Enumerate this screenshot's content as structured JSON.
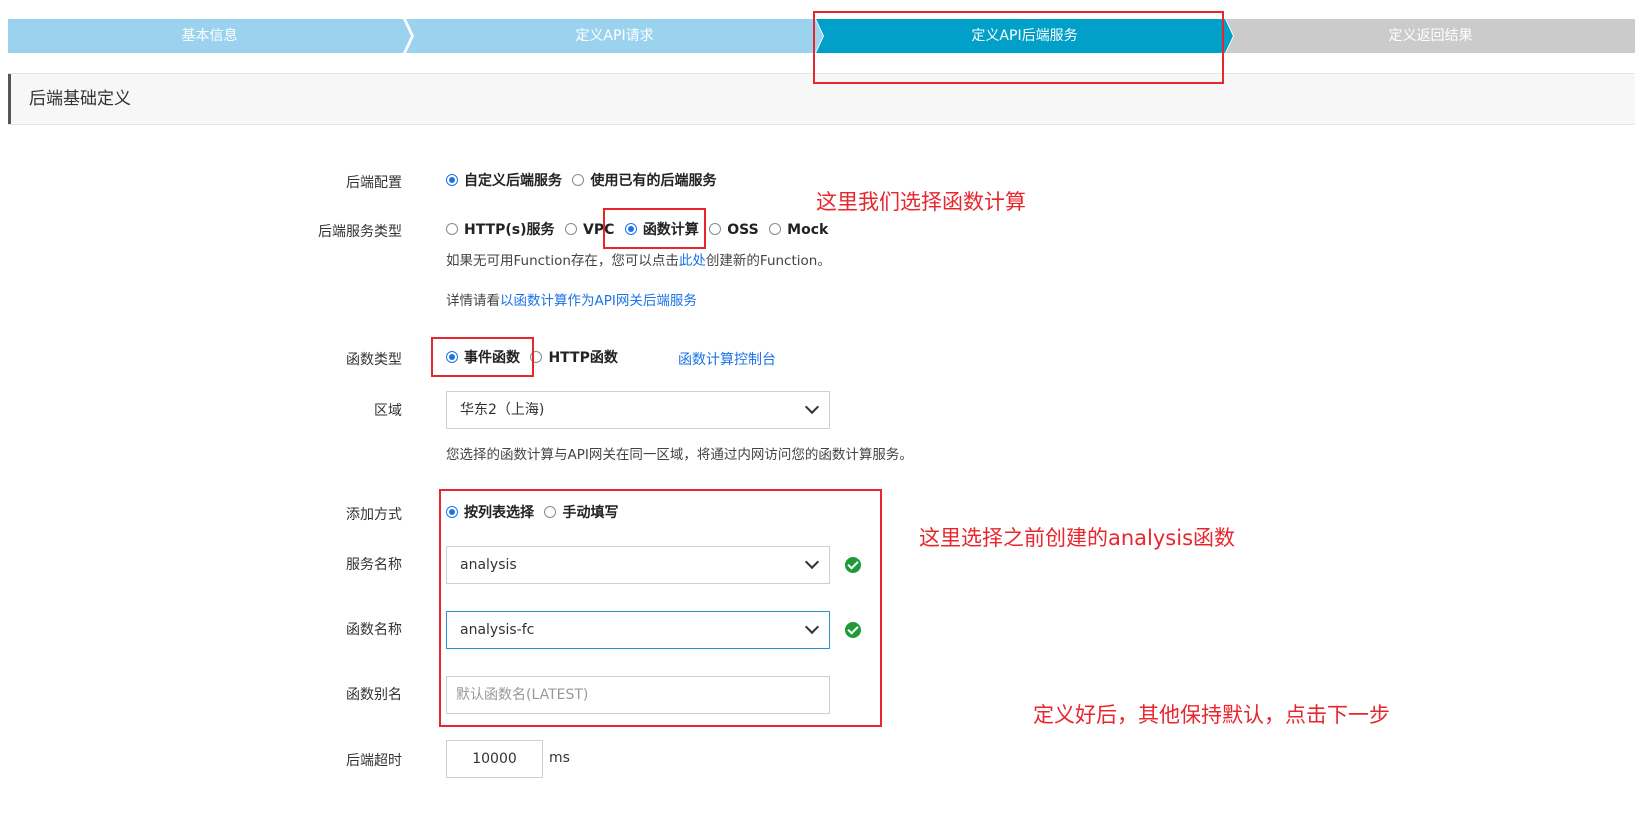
{
  "steps": [
    "基本信息",
    "定义API请求",
    "定义API后端服务",
    "定义返回结果"
  ],
  "section_title": "后端基础定义",
  "backend_config": {
    "label": "后端配置",
    "options": [
      "自定义后端服务",
      "使用已有的后端服务"
    ],
    "selected": "自定义后端服务"
  },
  "backend_type": {
    "label": "后端服务类型",
    "options": [
      "HTTP(s)服务",
      "VPC",
      "函数计算",
      "OSS",
      "Mock"
    ],
    "selected": "函数计算",
    "help1_prefix": "如果无可用Function存在，您可以点击",
    "help1_link": "此处",
    "help1_suffix": "创建新的Function。",
    "help2_prefix": "详情请看",
    "help2_link": "以函数计算作为API网关后端服务"
  },
  "function_type": {
    "label": "函数类型",
    "options": [
      "事件函数",
      "HTTP函数"
    ],
    "selected": "事件函数",
    "console_link": "函数计算控制台"
  },
  "region": {
    "label": "区域",
    "value": "华东2（上海)",
    "help": "您选择的函数计算与API网关在同一区域，将通过内网访问您的函数计算服务。"
  },
  "add_method": {
    "label": "添加方式",
    "options": [
      "按列表选择",
      "手动填写"
    ],
    "selected": "按列表选择"
  },
  "service_name": {
    "label": "服务名称",
    "value": "analysis"
  },
  "function_name": {
    "label": "函数名称",
    "value": "analysis-fc"
  },
  "function_alias": {
    "label": "函数别名",
    "placeholder": "默认函数名(LATEST)"
  },
  "timeout": {
    "label": "后端超时",
    "value": "10000",
    "unit": "ms"
  },
  "annotations": {
    "note1": "这里我们选择函数计算",
    "note2": "这里选择之前创建的analysis函数",
    "note3": "定义好后，其他保持默认，点击下一步"
  },
  "colors": {
    "annotation": "#e8262e",
    "active_step": "#00a0c8",
    "done_step": "#9bd3ef",
    "todo_step": "#cbcbcb",
    "link": "#1a73e8"
  }
}
